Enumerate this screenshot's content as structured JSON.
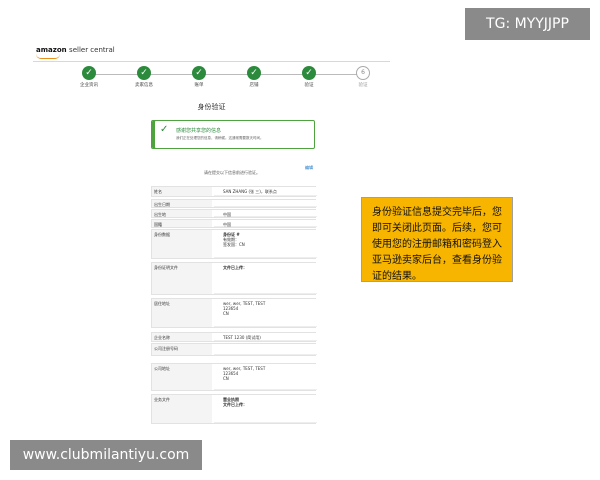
{
  "watermarks": {
    "top": "TG: MYYJJPP",
    "bottom": "www.clubmilantiyu.com"
  },
  "header": {
    "logo_brand": "amazon",
    "logo_suffix": "seller central"
  },
  "stepper": {
    "steps": [
      {
        "label": "企业资讯",
        "state": "done",
        "glyph": "✓"
      },
      {
        "label": "卖家信息",
        "state": "done",
        "glyph": "✓"
      },
      {
        "label": "账单",
        "state": "done",
        "glyph": "✓"
      },
      {
        "label": "店铺",
        "state": "done",
        "glyph": "✓"
      },
      {
        "label": "验证",
        "state": "done",
        "glyph": "✓"
      },
      {
        "label": "验证",
        "state": "pending",
        "glyph": "6"
      }
    ]
  },
  "page_title": "身份验证",
  "success": {
    "heading": "感谢您共享您的信息",
    "subtext": "我们正在处理您的信息，请稍候。这通常需要数天时间。"
  },
  "edit_link": "编辑",
  "review_note": "请在提交以下信息前进行验证。",
  "rows": [
    {
      "key": "姓名",
      "lines": [
        "SAN ZHANG (张 三)，联系点"
      ]
    },
    {
      "key": "出生日期",
      "lines": [
        ""
      ]
    },
    {
      "key": "出生地",
      "lines": [
        "中国"
      ]
    },
    {
      "key": "国籍",
      "lines": [
        "中国"
      ]
    },
    {
      "key": "身份数据",
      "lines": [
        "身份证 #",
        "有效期：",
        "签发国：CN"
      ]
    },
    {
      "key": "身份证明文件",
      "lines": [
        "文件已上传："
      ]
    },
    {
      "key": "居住地址",
      "lines": [
        "wer, wer, TEST, TEST",
        "123654",
        "CN"
      ]
    },
    {
      "key": "企业名称",
      "lines": [
        "TEST 1230 (简试用)"
      ]
    },
    {
      "key": "公司注册号码",
      "lines": [
        ""
      ]
    },
    {
      "key": "公司地址",
      "lines": [
        "wer, wer, TEST, TEST",
        "123654",
        "CN"
      ]
    },
    {
      "key": "业务文件",
      "lines": [
        "营业执照",
        "文件已上传："
      ]
    }
  ],
  "callout": {
    "text": "身份验证信息提交完毕后，您即可关闭此页面。后续，您可使用您的注册邮箱和密码登入亚马逊卖家后台，查看身份验证的结果。"
  },
  "colors": {
    "step_done": "#2c8a3c",
    "success_border": "#4ea33f",
    "link": "#0066c0",
    "callout_bg": "#f7b500",
    "watermark_bg": "#8a8a8a"
  }
}
